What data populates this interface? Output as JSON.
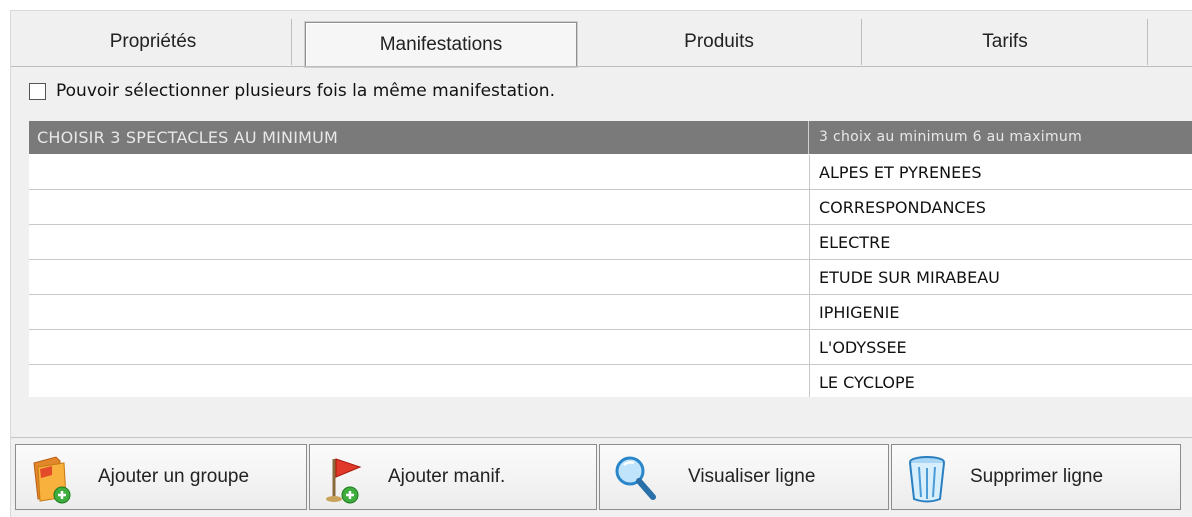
{
  "tabs": [
    {
      "label": "Propriétés",
      "active": false
    },
    {
      "label": "Manifestations",
      "active": true
    },
    {
      "label": "Produits",
      "active": false
    },
    {
      "label": "Tarifs",
      "active": false
    }
  ],
  "options": {
    "multi_select_label": "Pouvoir sélectionner plusieurs fois la même manifestation.",
    "multi_select_checked": false
  },
  "grid": {
    "group_label": "CHOISIR 3 SPECTACLES AU MINIMUM",
    "group_rule": "3 choix au minimum 6 au maximum",
    "items": [
      "ALPES ET PYRENEES",
      "CORRESPONDANCES",
      "ELECTRE",
      "ETUDE SUR MIRABEAU",
      "IPHIGENIE",
      "L'ODYSSEE",
      "LE CYCLOPE"
    ]
  },
  "toolbar": {
    "add_group": "Ajouter un groupe",
    "add_event": "Ajouter manif.",
    "view_line": "Visualiser ligne",
    "delete_line": "Supprimer ligne"
  },
  "icons": {
    "add_group": "folder-add-icon",
    "add_event": "flag-add-icon",
    "view_line": "magnifier-icon",
    "delete_line": "trash-icon"
  },
  "colors": {
    "header_bg": "#7a7a7a",
    "header_text": "#e8e8e8",
    "window_bg": "#f0f0f0"
  }
}
